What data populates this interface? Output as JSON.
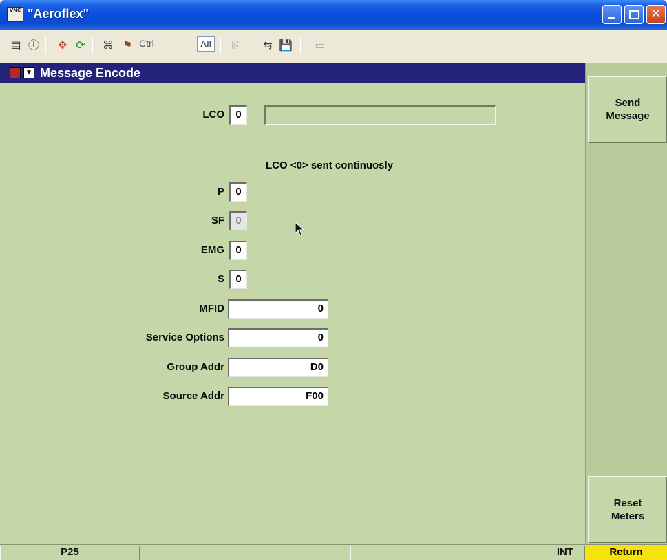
{
  "window": {
    "title": "\"Aeroflex\"",
    "app_icon_text": "VNC"
  },
  "toolbar": {
    "ctrl_label": "Ctrl",
    "alt_label": "Alt"
  },
  "panel": {
    "title": "Message Encode"
  },
  "form": {
    "lco": {
      "label": "LCO",
      "value": "0",
      "text": ""
    },
    "note": "LCO <0> sent continuosly",
    "p": {
      "label": "P",
      "value": "0"
    },
    "sf": {
      "label": "SF",
      "value": "0"
    },
    "emg": {
      "label": "EMG",
      "value": "0"
    },
    "s": {
      "label": "S",
      "value": "0"
    },
    "mfid": {
      "label": "MFID",
      "value": "0"
    },
    "service_options": {
      "label": "Service Options",
      "value": "0"
    },
    "group_addr": {
      "label": "Group Addr",
      "value": "D0"
    },
    "source_addr": {
      "label": "Source Addr",
      "value": "F00"
    }
  },
  "side": {
    "send_message": [
      "Send",
      "Message"
    ],
    "reset_meters": [
      "Reset",
      "Meters"
    ],
    "return": "Return"
  },
  "status": {
    "mode": "P25",
    "cell2": "",
    "cell3": "",
    "ref": "INT"
  }
}
